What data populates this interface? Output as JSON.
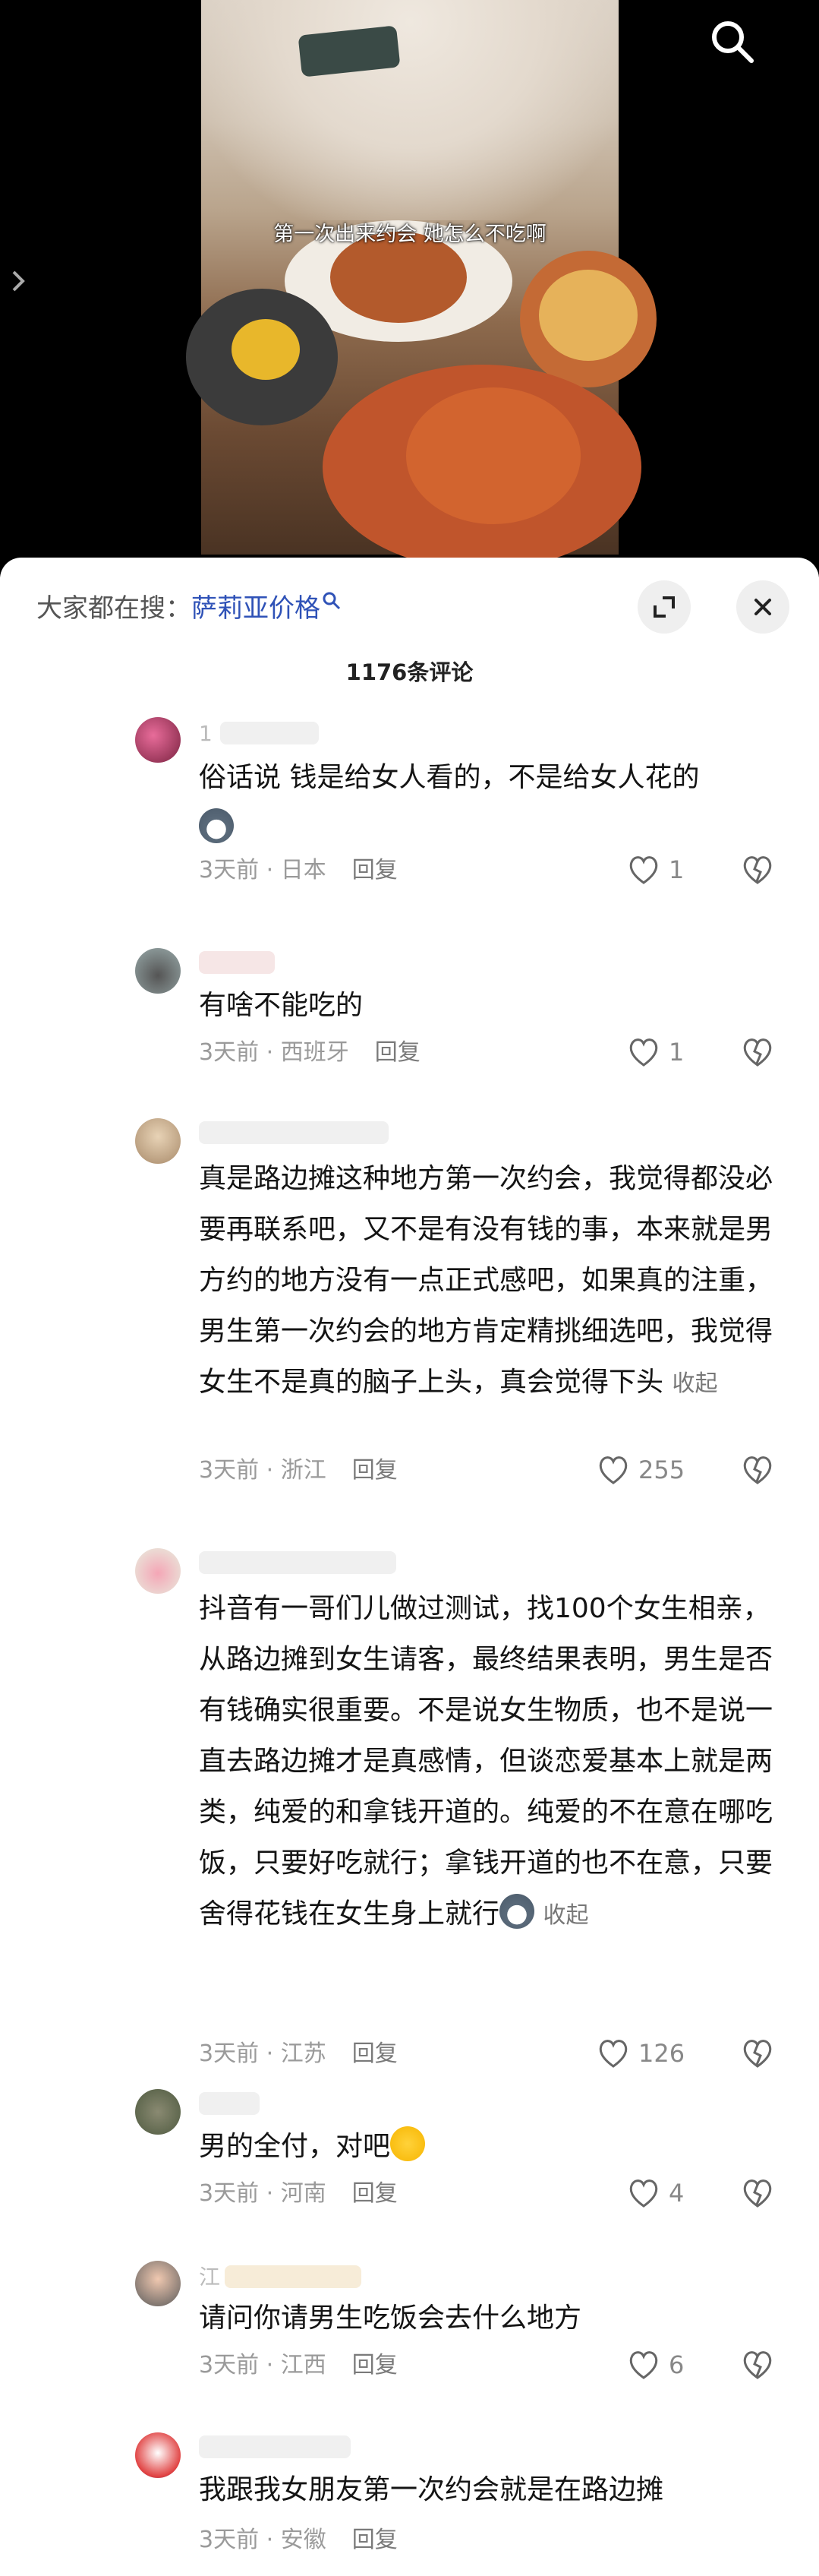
{
  "video": {
    "caption": "第一次出来约会 她怎么不吃啊",
    "icons": {
      "search": "search-icon",
      "left": "chevron-right-icon"
    }
  },
  "panel": {
    "search_prefix": "大家都在搜：",
    "search_keyword": "萨莉亚价格",
    "comment_count": "1176条评论",
    "icons": {
      "expand": "expand-icon",
      "close": "close-icon"
    }
  },
  "comments": [
    {
      "text": "俗话说 钱是给女人看的，不是给女人花的",
      "time": "3天前 · 日本",
      "reply": "回复",
      "likes": "1",
      "name_hint": "1"
    },
    {
      "text": "有啥不能吃的",
      "time": "3天前 · 西班牙",
      "reply": "回复",
      "likes": "1"
    },
    {
      "text": "真是路边摊这种地方第一次约会，我觉得都没必要再联系吧，又不是有没有钱的事，本来就是男方约的地方没有一点正式感吧，如果真的注重，男生第一次约会的地方肯定精挑细选吧，我觉得女生不是真的脑子上头，真会觉得下头",
      "fold": "收起",
      "time": "3天前 · 浙江",
      "reply": "回复",
      "likes": "255"
    },
    {
      "text": "抖音有一哥们儿做过测试，找100个女生相亲，从路边摊到女生请客，最终结果表明，男生是否有钱确实很重要。不是说女生物质，也不是说一直去路边摊才是真感情，但谈恋爱基本上就是两类，纯爱的和拿钱开道的。纯爱的不在意在哪吃饭，只要好吃就行；拿钱开道的也不在意，只要舍得花钱在女生身上就行",
      "fold": "收起",
      "time": "3天前 · 江苏",
      "reply": "回复",
      "likes": "126"
    },
    {
      "text": "男的全付，对吧",
      "time": "3天前 · 河南",
      "reply": "回复",
      "likes": "4"
    },
    {
      "text": "请问你请男生吃饭会去什么地方",
      "time": "3天前 · 江西",
      "reply": "回复",
      "likes": "6",
      "name_hint": "江"
    },
    {
      "text": "我跟我女朋友第一次约会就是在路边摊",
      "time": "3天前 · 安徽",
      "reply": "回复"
    }
  ],
  "colors": {
    "keyword": "#2f52b7",
    "meta": "#9a9a9a",
    "text": "#141414"
  }
}
